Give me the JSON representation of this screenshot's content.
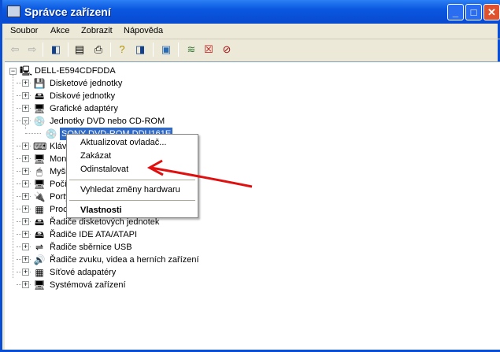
{
  "window": {
    "title": "Správce zařízení"
  },
  "menu": [
    "Soubor",
    "Akce",
    "Zobrazit",
    "Nápověda"
  ],
  "toolbar": [
    "back-icon",
    "forward-icon",
    "show-hide-tree-icon",
    "properties-icon",
    "print-icon",
    "help-icon",
    "show-hide-action-pane-icon",
    "scan-hardware-icon",
    "update-driver-icon",
    "uninstall-icon",
    "disable-icon"
  ],
  "tree": {
    "root": "DELL-E594CDFDDA",
    "items": [
      {
        "label": "Disketové jednotky",
        "expanded": false
      },
      {
        "label": "Diskové jednotky",
        "expanded": false
      },
      {
        "label": "Grafické adaptéry",
        "expanded": false
      },
      {
        "label": "Jednotky DVD nebo CD-ROM",
        "expanded": true
      },
      {
        "label": "SONY DVD-ROM DDU161E",
        "child": true,
        "selected": true
      },
      {
        "label": "Klávesnice",
        "expanded": false
      },
      {
        "label": "Monitory",
        "expanded": false
      },
      {
        "label": "Myši a jiná polohovací zařízení",
        "expanded": false
      },
      {
        "label": "Počítač",
        "expanded": false
      },
      {
        "label": "Porty (COM a LPT)",
        "expanded": false
      },
      {
        "label": "Procesory",
        "expanded": false
      },
      {
        "label": "Řadiče disketových jednotek",
        "expanded": false
      },
      {
        "label": "Řadiče IDE ATA/ATAPI",
        "expanded": false
      },
      {
        "label": "Řadiče sběrnice USB",
        "expanded": false
      },
      {
        "label": "Řadiče zvuku, videa a herních zařízení",
        "expanded": false
      },
      {
        "label": "Síťové adapatéry",
        "expanded": false
      },
      {
        "label": "Systémová zařízení",
        "expanded": false
      }
    ]
  },
  "context_menu": {
    "update": "Aktualizovat ovladač...",
    "disable": "Zakázat",
    "uninstall": "Odinstalovat",
    "scan": "Vyhledat změny hardwaru",
    "properties": "Vlastnosti"
  },
  "annotation_color": "#e01010"
}
